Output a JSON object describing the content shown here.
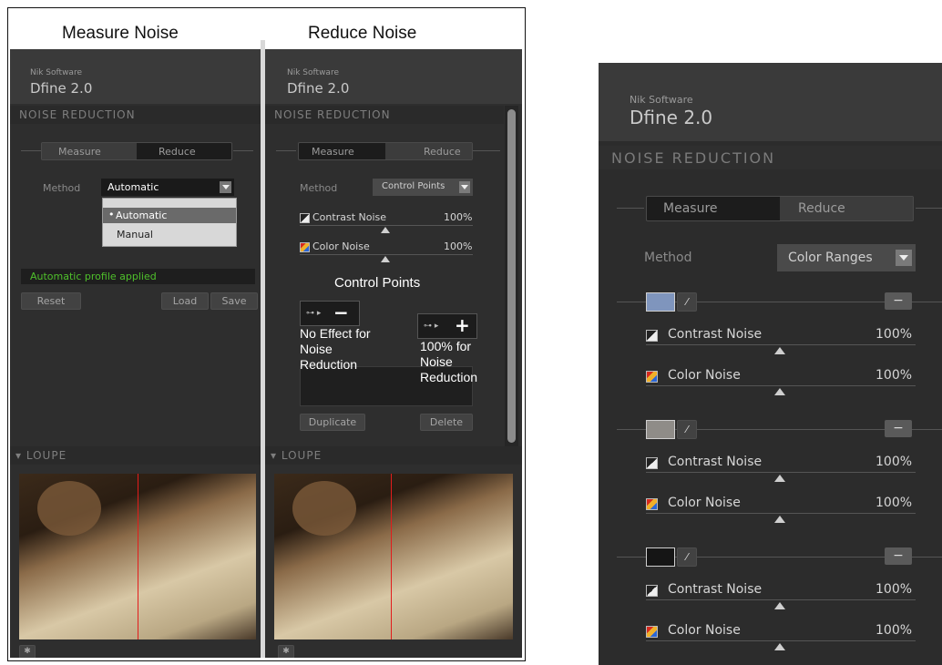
{
  "captions": {
    "measure": "Measure Noise",
    "reduce": "Reduce Noise"
  },
  "brand": {
    "company": "Nik Software",
    "product": "Dfine 2.0"
  },
  "section": {
    "noise_reduction": "NOISE REDUCTION",
    "loupe": "LOUPE"
  },
  "tabs": {
    "measure": "Measure",
    "reduce": "Reduce"
  },
  "method_label": "Method",
  "left": {
    "method_value": "Automatic",
    "options": [
      "Automatic",
      "Manual"
    ],
    "status": "Automatic profile applied",
    "reset": "Reset",
    "load": "Load",
    "save": "Save"
  },
  "middle": {
    "method_value": "Control Points",
    "contrast_label": "Contrast Noise",
    "contrast_value": "100%",
    "color_label": "Color Noise",
    "color_value": "100%",
    "cp_title": "Control Points",
    "minus_caption": "No Effect for Noise Reduction",
    "plus_caption": "100% for Noise Reduction",
    "duplicate": "Duplicate",
    "delete": "Delete",
    "minus_glyph": "−",
    "plus_glyph": "+"
  },
  "right": {
    "method_value": "Color Ranges",
    "ranges": [
      {
        "color": "#7f95bd",
        "contrast_label": "Contrast Noise",
        "contrast_value": "100%",
        "color_label": "Color Noise",
        "color_value": "100%"
      },
      {
        "color": "#8f8c88",
        "contrast_label": "Contrast Noise",
        "contrast_value": "100%",
        "color_label": "Color Noise",
        "color_value": "100%"
      },
      {
        "color": "#151515",
        "contrast_label": "Contrast Noise",
        "contrast_value": "100%",
        "color_label": "Color Noise",
        "color_value": "100%"
      }
    ]
  }
}
